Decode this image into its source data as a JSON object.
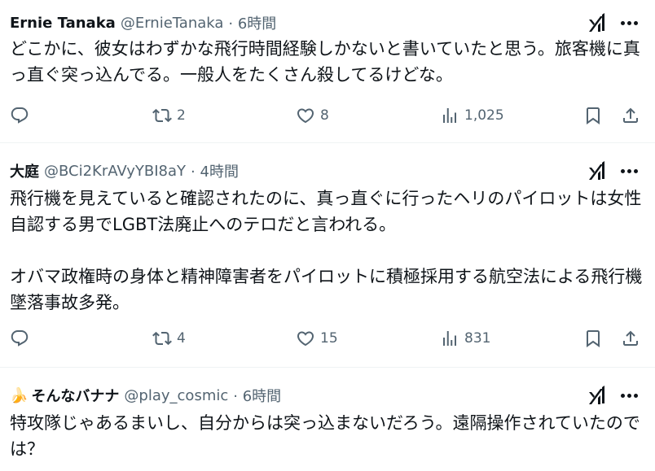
{
  "tweets": [
    {
      "name": "Ernie Tanaka",
      "handle": "@ErnieTanaka",
      "time": "· 6時間",
      "text": "どこかに、彼女はわずかな飛行時間経験しかないと書いていたと思う。旅客機に真っ直ぐ突っ込んでる。一般人をたくさん殺してるけどな。",
      "retweets": "2",
      "likes": "8",
      "views": "1,025"
    },
    {
      "name": "大庭",
      "handle": "@BCi2KrAVyYBI8aY",
      "time": "· 4時間",
      "text": "飛行機を見えていると確認されたのに、真っ直ぐに行ったヘリのパイロットは女性自認する男でLGBT法廃止へのテロだと言われる。\n\nオバマ政権時の身体と精神障害者をパイロットに積極採用する航空法による飛行機墜落事故多発。",
      "retweets": "4",
      "likes": "15",
      "views": "831"
    },
    {
      "emoji": "🍌",
      "name": "そんなバナナ",
      "handle": "@play_cosmic",
      "time": "· 6時間",
      "text": "特攻隊じゃあるまいし、自分からは突っ込まないだろう。遠隔操作されていたのでは？"
    }
  ],
  "icons": {
    "reply": "reply-icon",
    "retweet": "retweet-icon",
    "like": "heart-icon",
    "views": "views-icon",
    "bookmark": "bookmark-icon",
    "share": "share-icon",
    "grok": "grok-icon",
    "more": "more-icon"
  },
  "colors": {
    "text": "#0f1419",
    "secondary": "#536471",
    "divider": "#eff3f4"
  }
}
